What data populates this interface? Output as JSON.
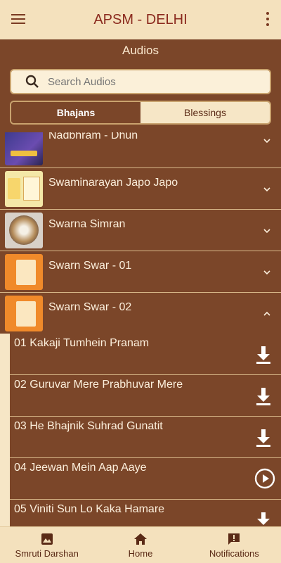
{
  "app": {
    "title": "APSM - DELHI"
  },
  "section": {
    "title": "Audios"
  },
  "search": {
    "placeholder": "Search Audios"
  },
  "tabs": [
    {
      "label": "Bhajans",
      "active": true
    },
    {
      "label": "Blessings",
      "active": false
    }
  ],
  "albums": [
    {
      "title": "Nadbhram - Dhun",
      "expanded": false
    },
    {
      "title": "Swaminarayan Japo Japo",
      "expanded": false
    },
    {
      "title": "Swarna Simran",
      "expanded": false
    },
    {
      "title": "Swarn Swar - 01",
      "expanded": false
    },
    {
      "title": "Swarn Swar - 02",
      "expanded": true
    }
  ],
  "tracks": [
    {
      "title": "01 Kakaji Tumhein  Pranam",
      "action": "download-icon"
    },
    {
      "title": "02 Guruvar Mere Prabhuvar Mere",
      "action": "download-icon"
    },
    {
      "title": "03 He Bhajnik Suhrad Gunatit",
      "action": "download-icon"
    },
    {
      "title": "04 Jeewan Mein Aap Aaye",
      "action": "play-icon"
    },
    {
      "title": "05 Viniti Sun Lo Kaka Hamare",
      "action": "download-icon"
    }
  ],
  "bottom_nav": [
    {
      "label": "Smruti Darshan",
      "icon": "gallery-icon"
    },
    {
      "label": "Home",
      "icon": "home-icon"
    },
    {
      "label": "Notifications",
      "icon": "notification-icon"
    }
  ],
  "colors": {
    "brown": "#7b4629",
    "cream": "#f4e1bd",
    "title_red": "#8b2a1e"
  }
}
